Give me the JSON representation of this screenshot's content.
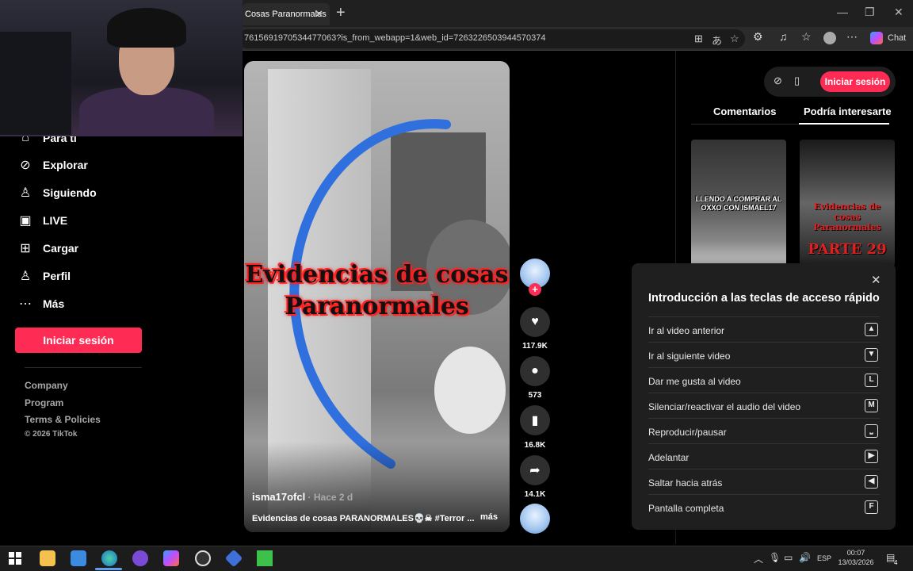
{
  "browser": {
    "tab_title": "Cosas Paranormales",
    "tab_close": "✕",
    "new_tab": "+",
    "url": "7615691970534477063?is_from_webapp=1&web_id=7263226503944570374",
    "chat_label": "Chat",
    "window_controls": {
      "minimize": "—",
      "restore": "❐",
      "close": "✕"
    }
  },
  "sidebar": {
    "partial_item": "Para ti",
    "items": [
      {
        "icon": "compass-icon",
        "label": "Explorar"
      },
      {
        "icon": "following-icon",
        "label": "Siguiendo"
      },
      {
        "icon": "live-icon",
        "label": "LIVE"
      },
      {
        "icon": "upload-icon",
        "label": "Cargar"
      },
      {
        "icon": "profile-icon",
        "label": "Perfil"
      },
      {
        "icon": "more-icon",
        "label": "Más"
      }
    ],
    "login_button": "Iniciar sesión",
    "footer_links": [
      "Company",
      "Program",
      "Terms & Policies"
    ],
    "copyright": "© 2026 TikTok"
  },
  "video": {
    "overlay_title": "Evidencias de cosas Paranormales",
    "author": "isma17ofcl",
    "time": " · Hace 2 d",
    "caption": "Evidencias de cosas PARANORMALES💀☠ #Terror ...",
    "more": "más"
  },
  "actions": {
    "likes": "117.9K",
    "comments": "573",
    "saves": "16.8K",
    "shares": "14.1K",
    "follow_plus": "+"
  },
  "right_panel": {
    "login_button": "Iniciar sesión",
    "tabs": [
      "Comentarios",
      "Podría interesarte"
    ],
    "active_tab": "Podría interesarte",
    "thumb1_text": "LLENDO A COMPRAR AL OXXO CON ISMAEL17",
    "thumb2_text": "Evidencias de cosas Paranormales",
    "thumb2_part": "PARTE 29"
  },
  "shortcuts_popup": {
    "title": "Introducción a las teclas de acceso rápido",
    "close": "✕",
    "rows": [
      {
        "label": "Ir al video anterior",
        "key": "▲"
      },
      {
        "label": "Ir al siguiente video",
        "key": "▼"
      },
      {
        "label": "Dar me gusta al video",
        "key": "L"
      },
      {
        "label": "Silenciar/reactivar el audio del video",
        "key": "M"
      },
      {
        "label": "Reproducir/pausar",
        "key": "⎵"
      },
      {
        "label": "Adelantar",
        "key": "▶"
      },
      {
        "label": "Saltar hacia atrás",
        "key": "◀"
      },
      {
        "label": "Pantalla completa",
        "key": "F"
      }
    ]
  },
  "taskbar": {
    "lang": "ESP",
    "time": "00:07",
    "date": "13/03/2026",
    "notification_count": "4"
  },
  "colors": {
    "brand": "#fe2c55",
    "background": "#000000",
    "panel": "#1f1f1f"
  }
}
